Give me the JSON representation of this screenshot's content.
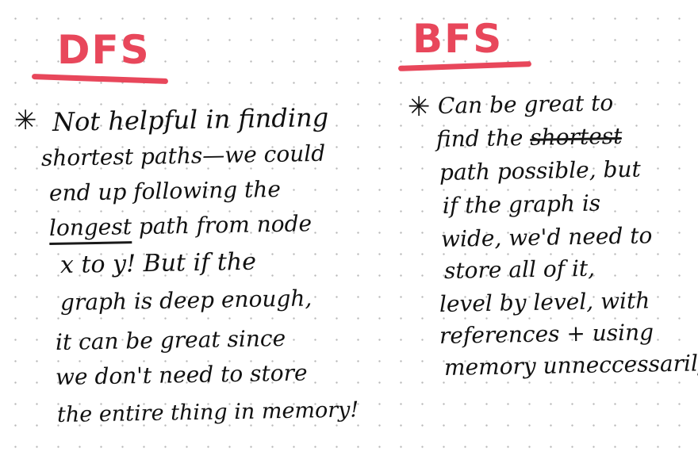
{
  "colors": {
    "ink": "#111111",
    "heading": "#e8475b",
    "underline": "#e8475b",
    "grid_dot": "#b9b9b9",
    "paper": "#ffffff"
  },
  "icons": {
    "bullet": "asterisk-icon"
  },
  "dfs": {
    "heading": "DFS",
    "bullet_glyph": "✳",
    "lines": [
      "Not helpful in finding",
      "shortest paths—we could",
      "end up following the",
      {
        "before": "",
        "emphasis": "longest",
        "after": " path from node"
      },
      "x to y! But if the",
      "graph is deep enough,",
      "it can be great since",
      "we don't need to store",
      "the entire thing in memory!"
    ]
  },
  "bfs": {
    "heading": "BFS",
    "bullet_glyph": "✳",
    "lines": [
      "Can be great to",
      {
        "before": "find the ",
        "emphasis": "shortest",
        "after": ""
      },
      "path possible, but",
      "if the graph is",
      "wide, we'd need to",
      "store all of it,",
      "level by level, with",
      "references + using",
      "memory unneccessarily!"
    ]
  }
}
